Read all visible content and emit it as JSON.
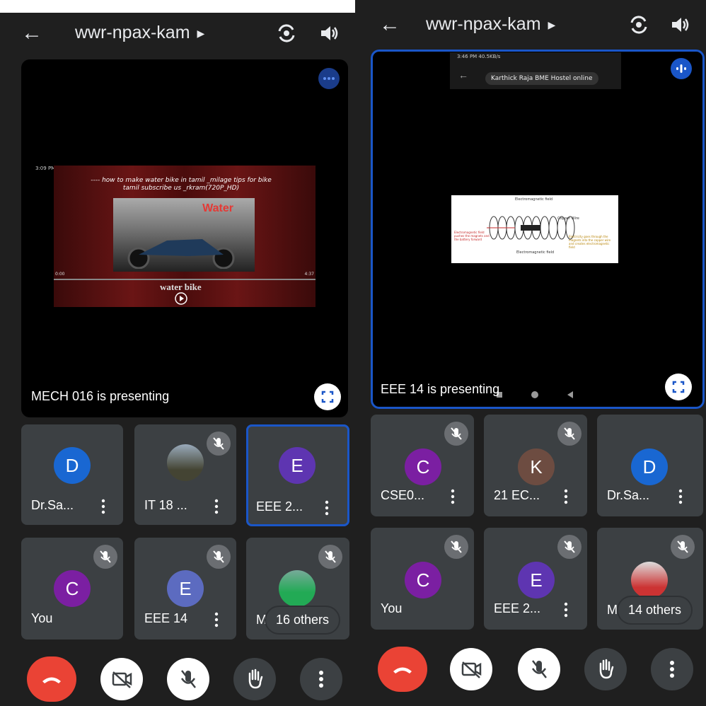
{
  "left": {
    "title": "wwr-npax-kam",
    "presenting": "MECH 016 is presenting",
    "video": {
      "status_time": "3:09 PM",
      "caption": "---- how to make water bike in tamil _milage tips for bike tamil subscribe us _rkram(720P_HD)",
      "overlay_word": "Water",
      "bottom_word": "water bike",
      "time_start": "0:00",
      "time_end": "4:37"
    },
    "tiles": [
      {
        "initial": "D",
        "name": "Dr.Sa...",
        "color": "#1967d2"
      },
      {
        "initial": "",
        "name": "IT 18 ...",
        "color": "#5f6368"
      },
      {
        "initial": "E",
        "name": "EEE 2...",
        "color": "#5e35b1"
      },
      {
        "initial": "C",
        "name": "You",
        "color": "#7b1fa2"
      },
      {
        "initial": "E",
        "name": "EEE 14",
        "color": "#5c6bc0"
      },
      {
        "initial": "",
        "name": "Me",
        "color": "#5f6368"
      }
    ],
    "others": "16 others"
  },
  "right": {
    "title": "wwr-npax-kam",
    "presenting": "EEE 14 is presenting",
    "screen": {
      "status_time": "3:46 PM 40.5KB/s",
      "notification": "Karthick Raja BME Hostel online",
      "diagram_labels": {
        "top": "Electromagnetic field",
        "wire": "Copper Wire",
        "left": "Electromagnetic field pushes the magnets and the battery forward",
        "right": "Electricity goes through the magnets into the copper wire and creates electromagnetic field",
        "bottom": "Electromagnetic field"
      }
    },
    "tiles": [
      {
        "initial": "C",
        "name": "CSE0...",
        "color": "#7b1fa2"
      },
      {
        "initial": "K",
        "name": "21 EC...",
        "color": "#6d4c41"
      },
      {
        "initial": "D",
        "name": "Dr.Sa...",
        "color": "#1967d2"
      },
      {
        "initial": "C",
        "name": "You",
        "color": "#7b1fa2"
      },
      {
        "initial": "E",
        "name": "EEE 2...",
        "color": "#5e35b1"
      },
      {
        "initial": "",
        "name": "M",
        "color": "#5f6368"
      }
    ],
    "others": "14 others"
  }
}
